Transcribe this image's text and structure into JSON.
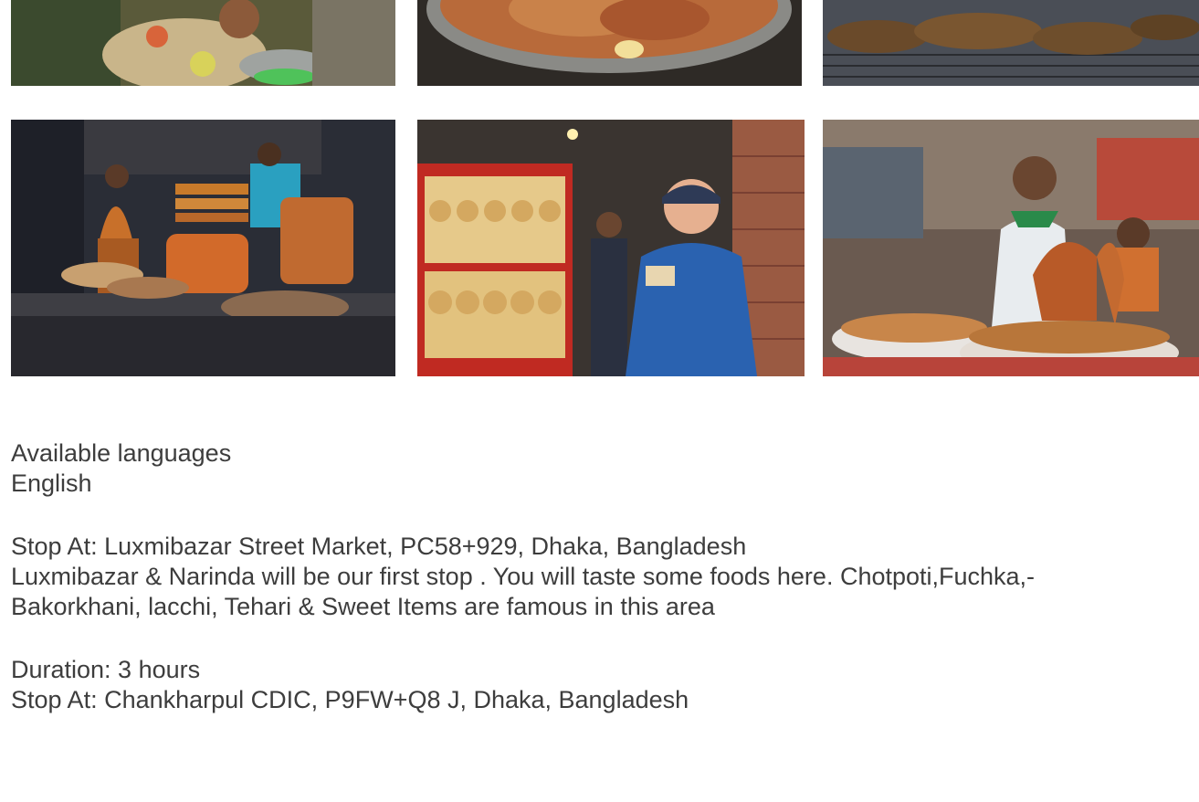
{
  "gallery": {
    "photos": [
      {
        "icon": "market-vendor-photo"
      },
      {
        "icon": "tehari-platter-photo"
      },
      {
        "icon": "kebab-grill-photo"
      },
      {
        "icon": "sweets-stall-photo"
      },
      {
        "icon": "bakorkhani-shop-photo"
      },
      {
        "icon": "roast-chicken-stall-photo"
      }
    ]
  },
  "details": {
    "languages_label": "Available languages",
    "languages_value": "English",
    "stop1": "Stop At: Luxmibazar Street Market, PC58+929, Dhaka, Bangladesh",
    "stop1_description_line1": "Luxmibazar & Narinda will be our first stop . You will taste some foods here. Chotpoti,Fuchka,-",
    "stop1_description_line2": "Bakorkhani, lacchi, Tehari & Sweet Items are famous in this area",
    "duration": "Duration: 3 hours",
    "stop2": "Stop At: Chankharpul CDIC, P9FW+Q8 J, Dhaka, Bangladesh"
  }
}
